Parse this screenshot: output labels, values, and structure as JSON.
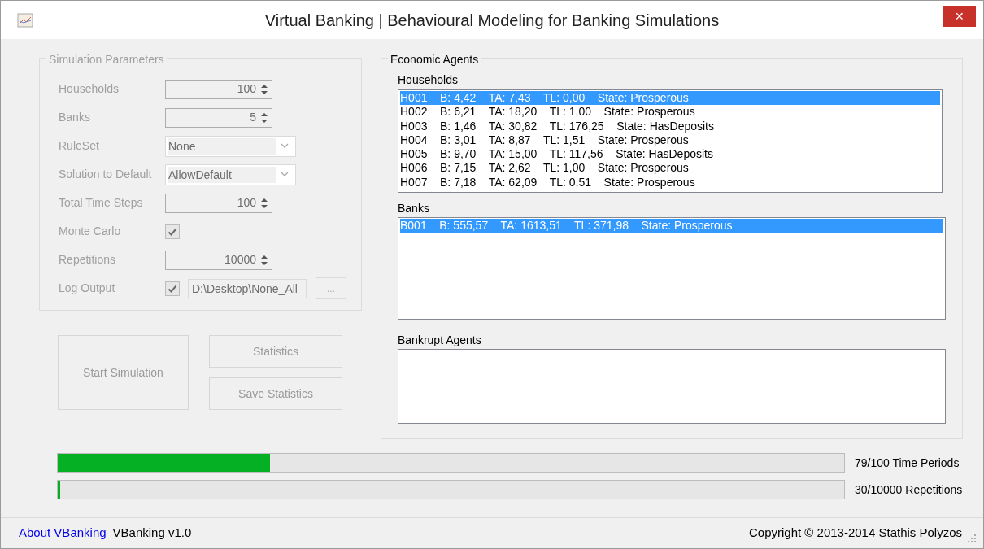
{
  "window": {
    "title": "Virtual Banking | Behavioural Modeling for Banking Simulations",
    "close": "✕"
  },
  "parameters": {
    "title": "Simulation Parameters",
    "items": [
      {
        "label": "Households",
        "kind": "spin",
        "value": "100",
        "disabled": true
      },
      {
        "label": "Banks",
        "kind": "spin",
        "value": "5",
        "disabled": true
      },
      {
        "label": "RuleSet",
        "kind": "combo",
        "value": "None",
        "disabled": true
      },
      {
        "label": "Solution to Default",
        "kind": "combo",
        "value": "AllowDefault",
        "disabled": true
      },
      {
        "label": "Total Time Steps",
        "kind": "spin",
        "value": "100",
        "disabled": true
      },
      {
        "label": "Monte Carlo",
        "kind": "check",
        "checked": true,
        "disabled": true
      },
      {
        "label": "Repetitions",
        "kind": "spin",
        "value": "10000",
        "disabled": true
      },
      {
        "label": "Log Output",
        "kind": "file",
        "checked": true,
        "value": "D:\\Desktop\\None_All",
        "browse": "...",
        "disabled": true
      }
    ]
  },
  "buttons": {
    "start": {
      "label": "Start Simulation",
      "disabled": true
    },
    "statistics": {
      "label": "Statistics",
      "disabled": true
    },
    "save": {
      "label": "Save Statistics",
      "disabled": true
    }
  },
  "agents": {
    "title": "Economic Agents",
    "households": {
      "title": "Households",
      "rows": [
        {
          "text": "H001    B: 4,42    TA: 7,43    TL: 0,00    State: Prosperous",
          "selected": true
        },
        {
          "text": "H002    B: 6,21    TA: 18,20    TL: 1,00    State: Prosperous",
          "selected": false
        },
        {
          "text": "H003    B: 1,46    TA: 30,82    TL: 176,25    State: HasDeposits",
          "selected": false
        },
        {
          "text": "H004    B: 3,01    TA: 8,87    TL: 1,51    State: Prosperous",
          "selected": false
        },
        {
          "text": "H005    B: 9,70    TA: 15,00    TL: 117,56    State: HasDeposits",
          "selected": false
        },
        {
          "text": "H006    B: 7,15    TA: 2,62    TL: 1,00    State: Prosperous",
          "selected": false
        },
        {
          "text": "H007    B: 7,18    TA: 62,09    TL: 0,51    State: Prosperous",
          "selected": false
        }
      ]
    },
    "banks": {
      "title": "Banks",
      "rows": [
        {
          "text": "B001    B: 555,57    TA: 1613,51    TL: 371,98    State: Prosperous",
          "selected": true
        }
      ]
    },
    "bankrupt": {
      "title": "Bankrupt Agents"
    }
  },
  "progress": [
    {
      "level": 0.27,
      "reading": "79/100 Time Periods"
    },
    {
      "level": 0.003,
      "reading": "30/10000 Repetitions"
    }
  ],
  "status_bar": {
    "link": "About VBanking",
    "version": "VBanking v1.0",
    "copyright": "Copyright © 2013-2014 Stathis Polyzos"
  }
}
